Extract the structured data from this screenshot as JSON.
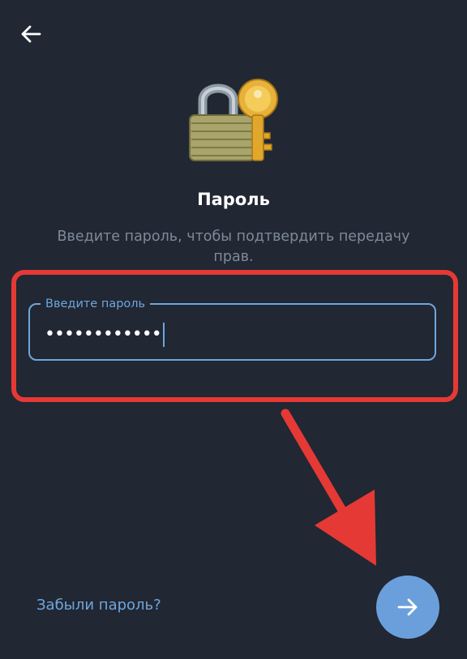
{
  "header": {
    "back_icon": "arrow-left-icon"
  },
  "hero": {
    "icon": "lock-with-key-icon"
  },
  "title": "Пароль",
  "subtitle": "Введите пароль, чтобы подтвердить передачу прав.",
  "password_field": {
    "label": "Введите пароль",
    "value": "••••••••••••"
  },
  "forgot_link": "Забыли пароль?",
  "next_button": {
    "icon": "arrow-right-icon"
  },
  "colors": {
    "background": "#212733",
    "accent": "#6fa6dc",
    "annotation_red": "#e53935"
  }
}
